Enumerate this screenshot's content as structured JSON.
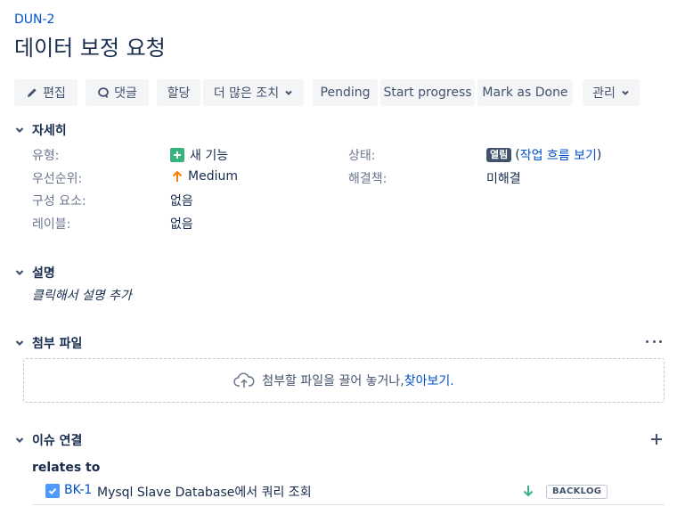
{
  "issue": {
    "key": "DUN-2",
    "title": "데이터 보정 요청"
  },
  "toolbar": {
    "edit_label": "편집",
    "comment_label": "댓글",
    "assign_label": "할당",
    "more_actions_label": "더 많은 조치",
    "pending_label": "Pending",
    "start_progress_label": "Start progress",
    "mark_done_label": "Mark as Done",
    "admin_label": "관리"
  },
  "details": {
    "heading": "자세히",
    "type_label": "유형:",
    "type_value": "새 기능",
    "priority_label": "우선순위:",
    "priority_value": "Medium",
    "component_label": "구성 요소:",
    "component_value": "없음",
    "labels_label": "레이블:",
    "labels_value": "없음",
    "status_label": "상태:",
    "status_lozenge": "열림",
    "workflow_open": "(",
    "workflow_link": "작업 흐름 보기",
    "workflow_close": ")",
    "resolution_label": "해결책:",
    "resolution_value": "미해결"
  },
  "description": {
    "heading": "설명",
    "placeholder": "클릭해서 설명 추가"
  },
  "attachments": {
    "heading": "첨부 파일",
    "drop_text": "첨부할 파일을 끌어 놓거나, ",
    "browse_link": "찾아보기."
  },
  "issue_links": {
    "heading": "이슈 연결",
    "relation": "relates to",
    "items": [
      {
        "key": "BK-1",
        "summary": "Mysql Slave Database에서 쿼리 조회",
        "status": "BACKLOG",
        "priority_icon": "arrow-down-green"
      }
    ]
  },
  "colors": {
    "link": "#0052cc",
    "button_bg": "#f4f5f7",
    "new_feature_green": "#36b37e",
    "priority_medium": "#ff7a00",
    "priority_low": "#36b37e",
    "lozenge_bg": "#42526e"
  }
}
